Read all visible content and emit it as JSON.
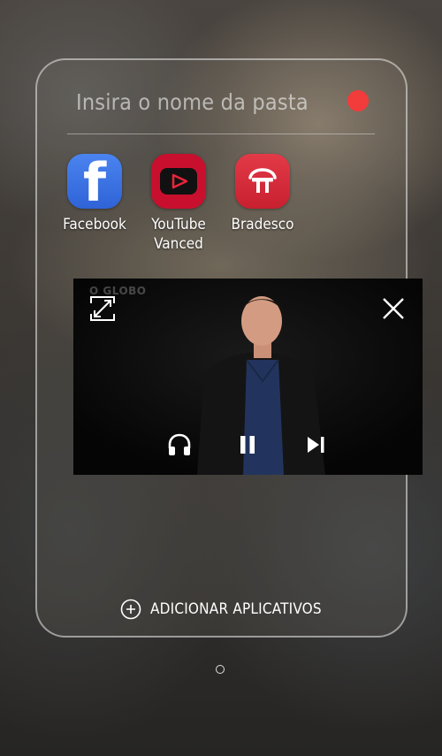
{
  "folder": {
    "name_placeholder": "Insira o nome da pasta",
    "color": "#f23b3b",
    "apps": [
      {
        "label": "Facebook",
        "icon": "facebook-app-icon"
      },
      {
        "label": "YouTube\nVanced",
        "icon": "youtube-vanced-app-icon"
      },
      {
        "label": "Bradesco",
        "icon": "bradesco-app-icon"
      }
    ],
    "add_apps_label": "ADICIONAR APLICATIVOS"
  },
  "video_player": {
    "watermark": "O GLOBO",
    "controls": [
      "expand-icon",
      "close-icon",
      "headphones-icon",
      "pause-icon",
      "skip-next-icon"
    ]
  },
  "pager": {
    "current_page": 1,
    "total_pages": 1
  }
}
